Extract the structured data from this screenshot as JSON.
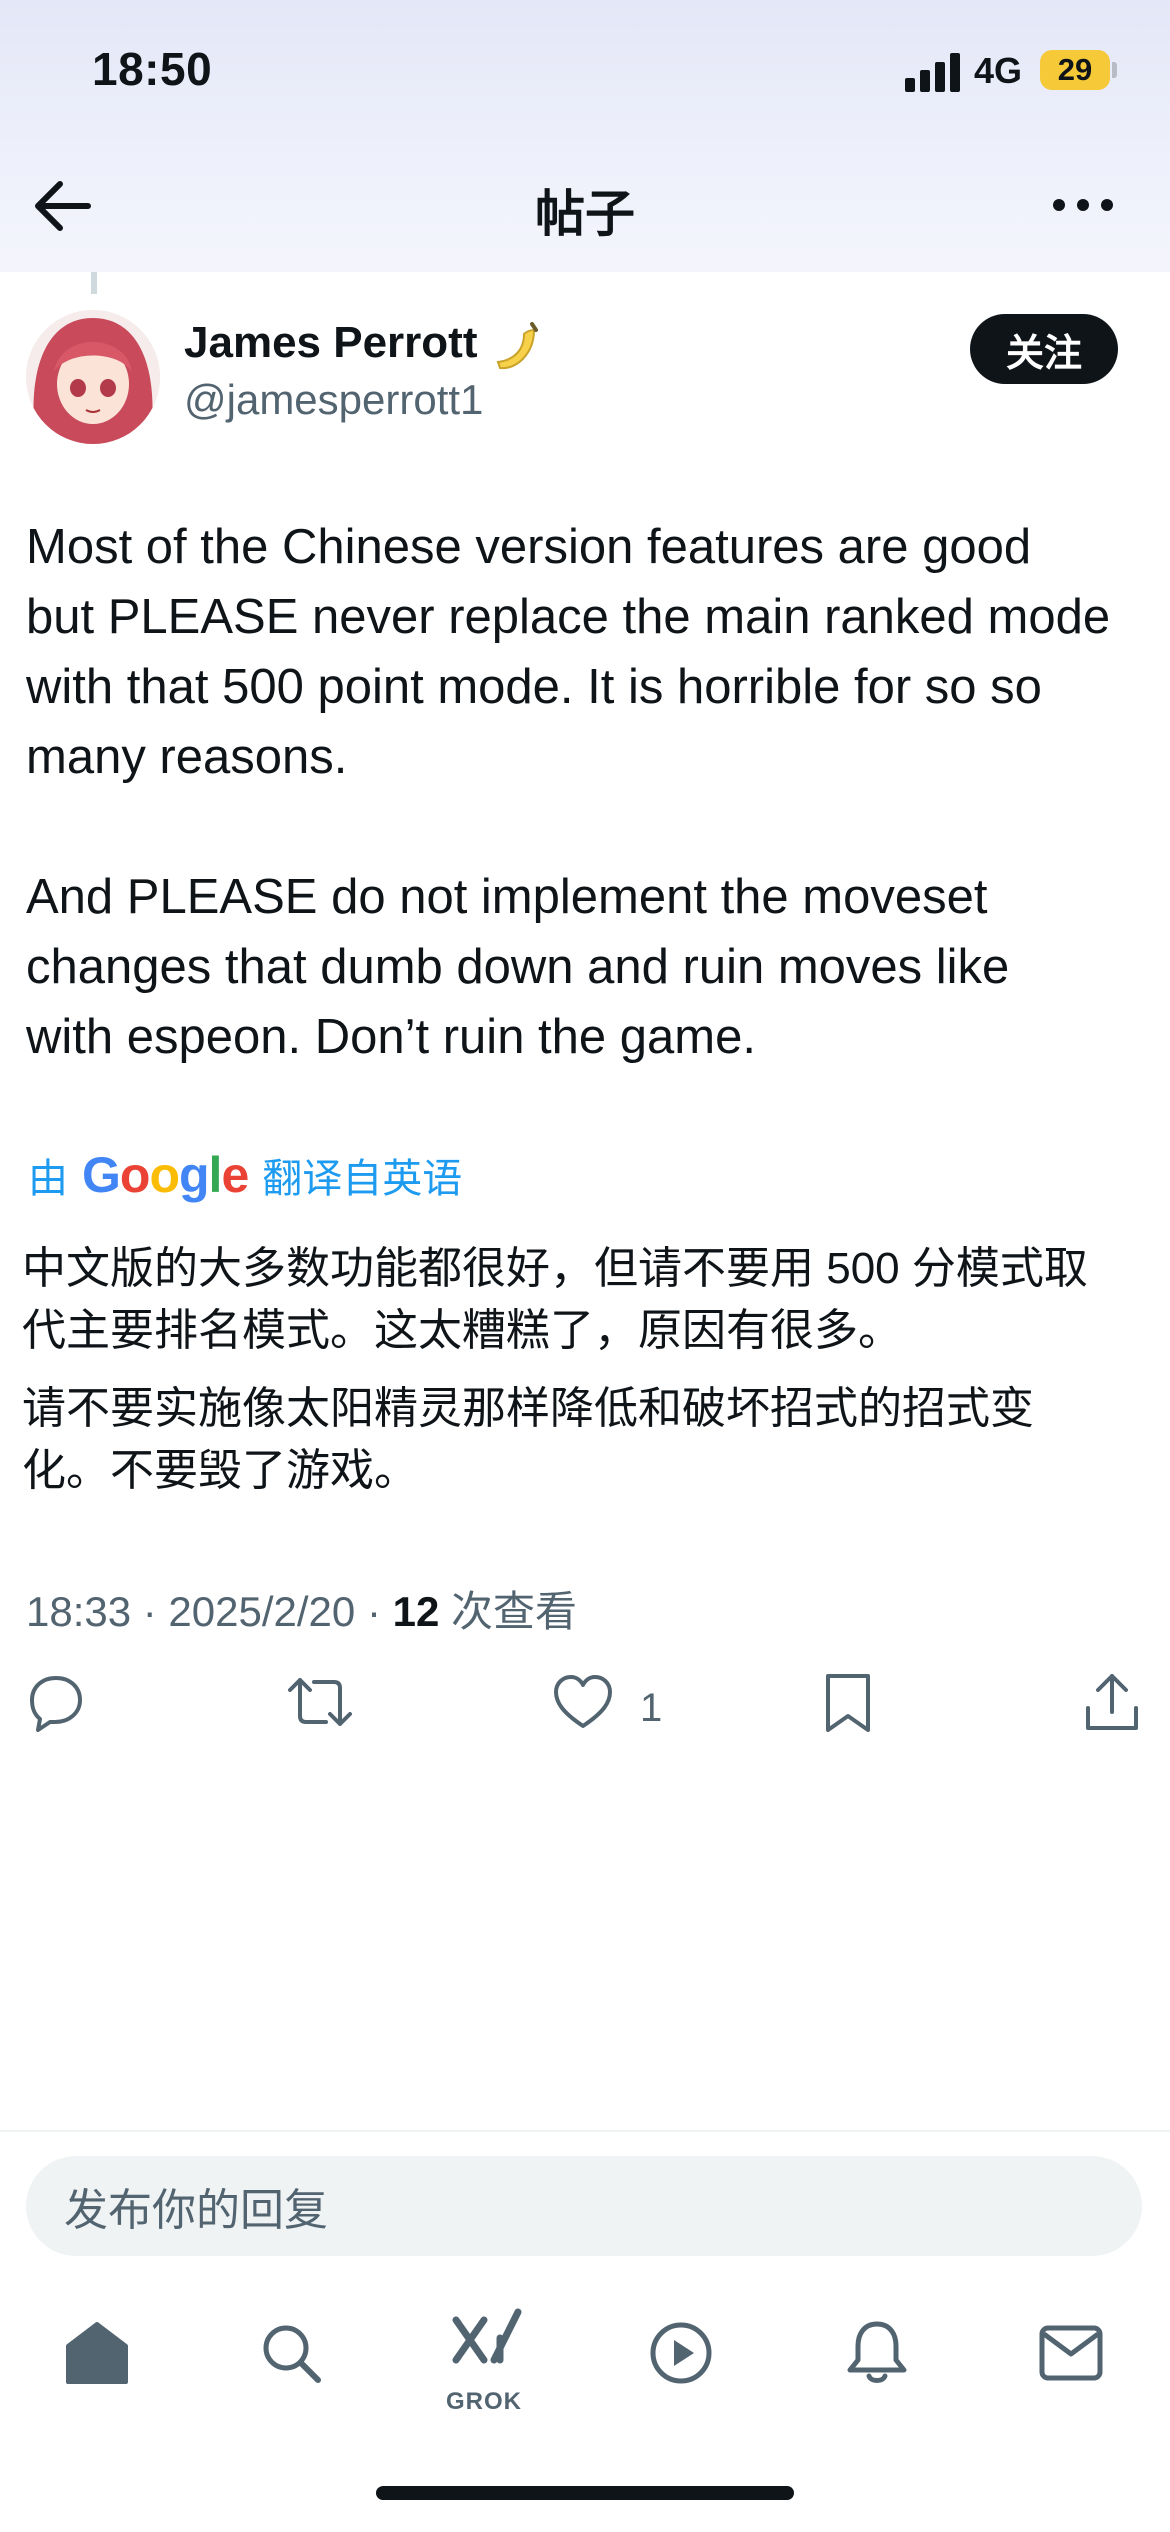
{
  "status_bar": {
    "time": "18:50",
    "network": "4G",
    "battery": "29"
  },
  "header": {
    "title": "帖子"
  },
  "post": {
    "author_name": "James Perrott",
    "handle": "@jamesperrott1",
    "follow_label": "关注",
    "body": "Most of the Chinese version features are good\nbut PLEASE never replace the main ranked mode\nwith that 500 point mode. It is horrible for so so\nmany reasons.\n\nAnd PLEASE do not implement the moveset\nchanges that dumb down and ruin moves like\nwith espeon. Don’t ruin the game.",
    "translation": {
      "prefix": "由",
      "google": [
        "G",
        "o",
        "o",
        "g",
        "l",
        "e"
      ],
      "suffix": "翻译自英语",
      "text_1": "中文版的大多数功能都很好，但请不要用 500 分模式取\n代主要排名模式。这太糟糕了，原因有很多。",
      "text_2": "请不要实施像太阳精灵那样降低和破坏招式的招式变\n化。不要毁了游戏。"
    },
    "timestamp": "18:33 · 2025/2/20 · ",
    "views_count": "12",
    "views_label": " 次查看",
    "like_count": "1"
  },
  "reply": {
    "placeholder": "发布你的回复"
  },
  "tabbar": {
    "grok_label": "GROK"
  },
  "icons": {
    "back": "arrow-left-icon",
    "more": "more-dots-icon",
    "reply": "reply-icon",
    "repost": "repost-icon",
    "like": "heart-icon",
    "bookmark": "bookmark-icon",
    "share": "share-icon",
    "home": "home-icon",
    "search": "search-icon",
    "grok": "grok-icon",
    "video": "play-icon",
    "notifications": "bell-icon",
    "messages": "mail-icon"
  },
  "colors": {
    "accent": "#1d9bf0",
    "text": "#0f1419",
    "muted": "#536471",
    "battery": "#f5c938"
  }
}
